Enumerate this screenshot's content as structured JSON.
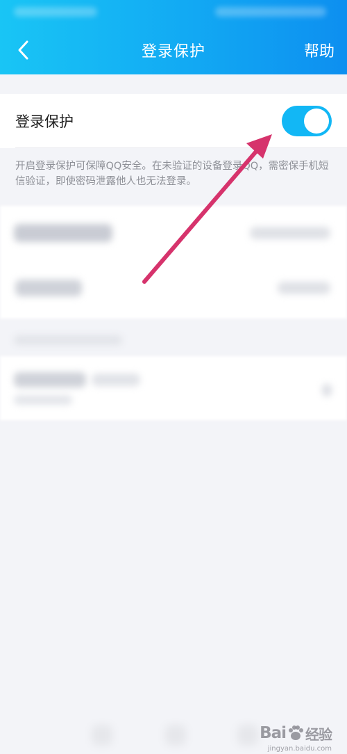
{
  "header": {
    "title": "登录保护",
    "help_label": "帮助",
    "back_icon": "chevron-left-icon"
  },
  "protection": {
    "label": "登录保护",
    "enabled": true,
    "description": "开启登录保护可保障QQ安全。在未验证的设备登录QQ，需密保手机短信验证，即使密码泄露他人也无法登录。"
  },
  "colors": {
    "header_start": "#19c5f5",
    "header_end": "#0d8ff0",
    "switch_on": "#12b7f5",
    "arrow": "#d6336c"
  },
  "watermark": {
    "logo_text": "Bai",
    "logo_suffix": "经验",
    "url": "jingyan.baidu.com"
  }
}
